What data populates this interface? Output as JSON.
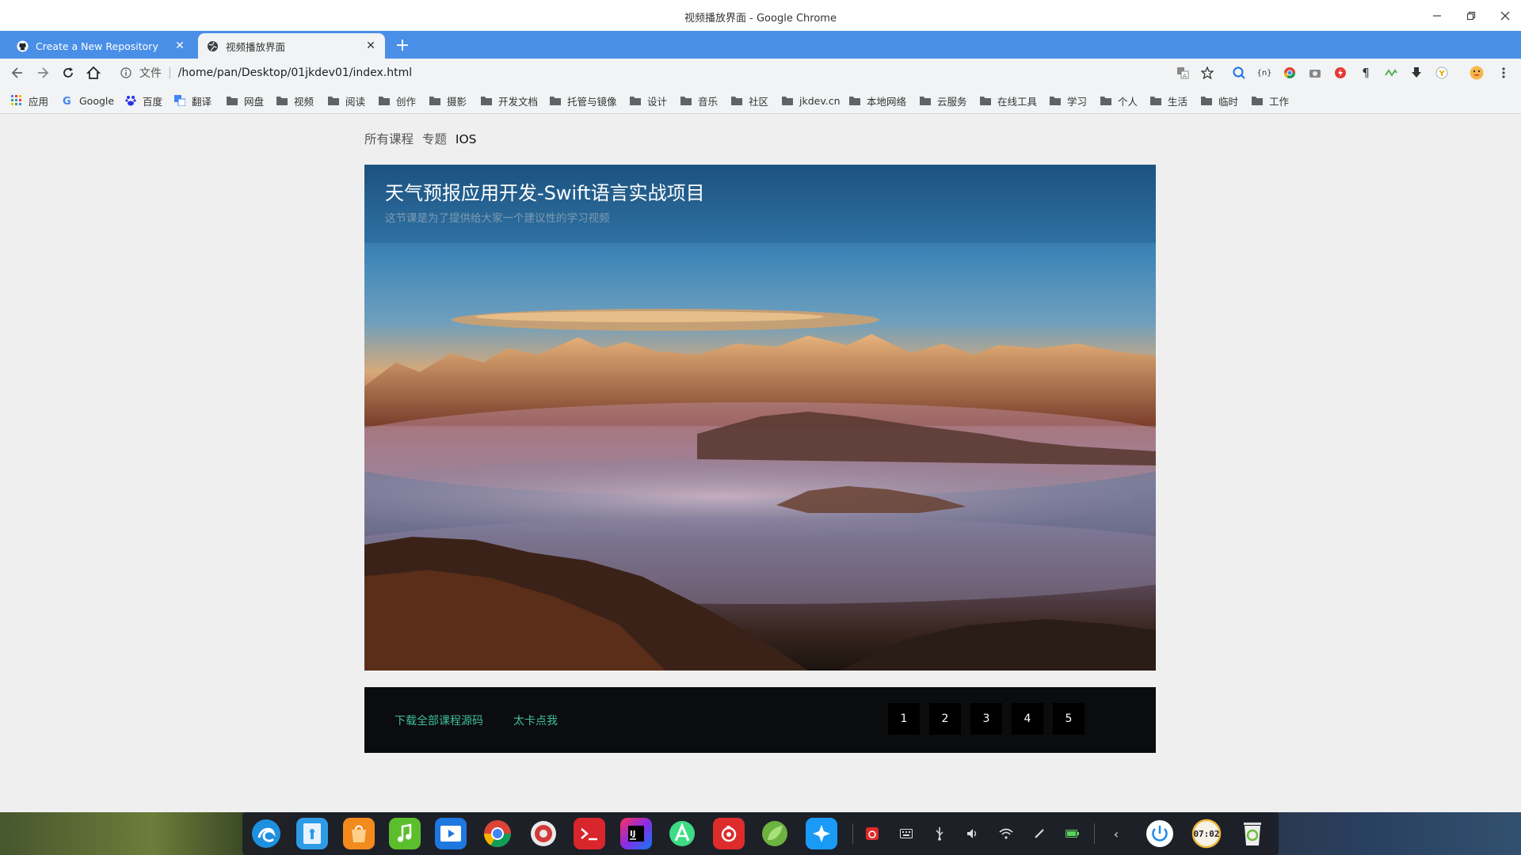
{
  "window": {
    "title": "视频播放界面 - Google Chrome",
    "minimize_icon": "minimize-icon",
    "restore_icon": "restore-icon",
    "close_icon": "close-icon"
  },
  "tabs": [
    {
      "title": "Create a New Repository",
      "favicon": "github-icon",
      "active": false
    },
    {
      "title": "视频播放界面",
      "favicon": "globe-icon",
      "active": true
    }
  ],
  "toolbar": {
    "scheme_label": "文件",
    "url": "/home/pan/Desktop/01jkdev01/index.html",
    "extensions": [
      "translate-icon",
      "bookmark-star-icon",
      "search-ext-icon",
      "code-ext-icon",
      "chrome-ext-icon",
      "camera-ext-icon",
      "flash-ext-icon",
      "paragraph-ext-icon",
      "wave-ext-icon",
      "download-ext-icon",
      "y-ext-icon",
      "profile-avatar-icon",
      "menu-icon"
    ]
  },
  "bookmarks": [
    {
      "label": "应用",
      "icon": "apps-grid-icon"
    },
    {
      "label": "Google",
      "icon": "google-icon"
    },
    {
      "label": "百度",
      "icon": "baidu-icon"
    },
    {
      "label": "翻译",
      "icon": "translate-icon"
    },
    {
      "label": "网盘",
      "icon": "folder-icon"
    },
    {
      "label": "视频",
      "icon": "folder-icon"
    },
    {
      "label": "阅读",
      "icon": "folder-icon"
    },
    {
      "label": "创作",
      "icon": "folder-icon"
    },
    {
      "label": "摄影",
      "icon": "folder-icon"
    },
    {
      "label": "开发文档",
      "icon": "folder-icon"
    },
    {
      "label": "托管与镜像",
      "icon": "folder-icon"
    },
    {
      "label": "设计",
      "icon": "folder-icon"
    },
    {
      "label": "音乐",
      "icon": "folder-icon"
    },
    {
      "label": "社区",
      "icon": "folder-icon"
    },
    {
      "label": "jkdev.cn",
      "icon": "folder-icon"
    },
    {
      "label": "本地网络",
      "icon": "folder-icon"
    },
    {
      "label": "云服务",
      "icon": "folder-icon"
    },
    {
      "label": "在线工具",
      "icon": "folder-icon"
    },
    {
      "label": "学习",
      "icon": "folder-icon"
    },
    {
      "label": "个人",
      "icon": "folder-icon"
    },
    {
      "label": "生活",
      "icon": "folder-icon"
    },
    {
      "label": "临时",
      "icon": "folder-icon"
    },
    {
      "label": "工作",
      "icon": "folder-icon"
    }
  ],
  "page": {
    "breadcrumb": [
      "所有课程",
      "专题",
      "IOS"
    ],
    "hero": {
      "title": "天气预报应用开发-Swift语言实战项目",
      "subtitle": "这节课是为了提供给大家一个建议性的学习视频",
      "image": "mountain-landscape-image"
    },
    "footer": {
      "links": [
        "下载全部课程源码",
        "太卡点我"
      ],
      "pages": [
        "1",
        "2",
        "3",
        "4",
        "5"
      ]
    }
  },
  "dock": {
    "apps": [
      "deepin-launcher-icon",
      "file-manager-icon",
      "app-store-icon",
      "music-player-icon",
      "video-player-icon",
      "chrome-icon",
      "settings-icon",
      "terminal-icon",
      "intellij-icon",
      "android-studio-icon",
      "netease-music-icon",
      "spring-icon",
      "lantern-icon"
    ],
    "tray": [
      "netease-tray-icon",
      "keyboard-icon",
      "usb-icon",
      "volume-icon",
      "wifi-icon",
      "pen-icon",
      "battery-icon",
      "collapse-arrow-icon"
    ],
    "power_icon": "power-icon",
    "clock": "07:02",
    "trash_icon": "trash-icon"
  },
  "colors": {
    "tabstrip": "#4a8fe7",
    "footer_bg": "#0b0c0e",
    "footer_link": "#3fbf9a",
    "page_bg": "#efefef"
  }
}
